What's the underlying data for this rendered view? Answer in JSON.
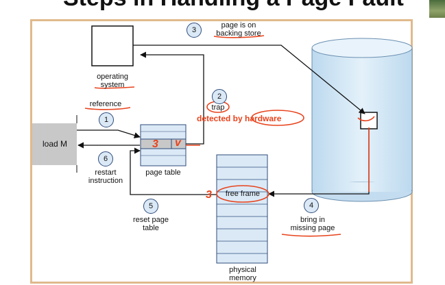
{
  "title": "Steps in Handling a Page Fault",
  "labels": {
    "os": "operating\nsystem",
    "reference": "reference",
    "load": "load M",
    "trap": "trap",
    "page_on_store": "page is on\nbacking store",
    "restart": "restart\ninstruction",
    "page_table": "page table",
    "free_frame": "free frame",
    "reset": "reset page\ntable",
    "bring": "bring in\nmissing page",
    "physical_memory": "physical\nmemory",
    "annotation": "detected by hardware",
    "pt_mark_1": "3",
    "pt_mark_2": "v",
    "ff_mark": "3"
  },
  "steps": [
    "1",
    "2",
    "3",
    "4",
    "5",
    "6"
  ],
  "colors": {
    "frame_border": "#e0b98c",
    "annotation_red": "#e8421b",
    "memory_fill": "#dbe9f6",
    "program_fill": "#c8c8c8",
    "page_table_fill": "#dbe9f6",
    "disk_fill": "#d6e8f4"
  }
}
